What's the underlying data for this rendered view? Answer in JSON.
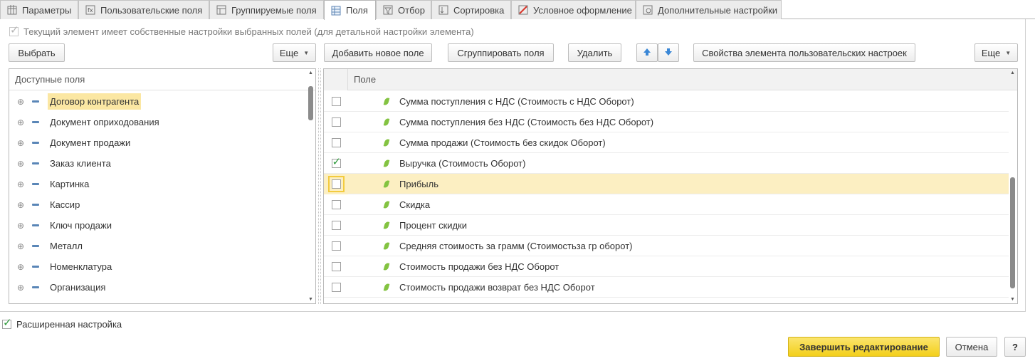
{
  "tabs": [
    {
      "label": "Параметры",
      "icon": "parameters-icon",
      "active": false
    },
    {
      "label": "Пользовательские поля",
      "icon": "custom-fields-icon",
      "active": false
    },
    {
      "label": "Группируемые поля",
      "icon": "grouped-fields-icon",
      "active": false
    },
    {
      "label": "Поля",
      "icon": "fields-icon",
      "active": true
    },
    {
      "label": "Отбор",
      "icon": "filter-icon",
      "active": false
    },
    {
      "label": "Сортировка",
      "icon": "sort-icon",
      "active": false
    },
    {
      "label": "Условное оформление",
      "icon": "conditional-format-icon",
      "active": false
    },
    {
      "label": "Дополнительные настройки",
      "icon": "settings-icon",
      "active": false
    }
  ],
  "own_settings_label": "Текущий элемент имеет собственные настройки выбранных полей (для детальной настройки элемента)",
  "own_settings_checked": true,
  "toolbar_left": {
    "select_label": "Выбрать",
    "more_label": "Еще"
  },
  "toolbar_right": {
    "add_field_label": "Добавить новое поле",
    "group_fields_label": "Сгруппировать поля",
    "delete_label": "Удалить",
    "move_up_icon": "arrow-up-icon",
    "move_down_icon": "arrow-down-icon",
    "properties_label": "Свойства элемента пользовательских настроек",
    "more_label": "Еще"
  },
  "available_fields": {
    "header": "Доступные поля",
    "items": [
      {
        "label": "Договор контрагента",
        "selected": true
      },
      {
        "label": "Документ оприходования",
        "selected": false
      },
      {
        "label": "Документ продажи",
        "selected": false
      },
      {
        "label": "Заказ клиента",
        "selected": false
      },
      {
        "label": "Картинка",
        "selected": false
      },
      {
        "label": "Кассир",
        "selected": false
      },
      {
        "label": "Ключ продажи",
        "selected": false
      },
      {
        "label": "Металл",
        "selected": false
      },
      {
        "label": "Номенклатура",
        "selected": false
      },
      {
        "label": "Организация",
        "selected": false
      }
    ]
  },
  "selected_fields": {
    "header": "Поле",
    "items": [
      {
        "label": "Сумма поступления с НДС (Стоимость с НДС Оборот)",
        "checked": false,
        "selected": false
      },
      {
        "label": "Сумма поступления без НДС (Стоимость без НДС Оборот)",
        "checked": false,
        "selected": false
      },
      {
        "label": "Сумма продажи (Стоимость без скидок Оборот)",
        "checked": false,
        "selected": false
      },
      {
        "label": "Выручка (Стоимость Оборот)",
        "checked": true,
        "selected": false
      },
      {
        "label": "Прибыль",
        "checked": false,
        "selected": true
      },
      {
        "label": "Скидка",
        "checked": false,
        "selected": false
      },
      {
        "label": "Процент скидки",
        "checked": false,
        "selected": false
      },
      {
        "label": "Средняя стоимость за грамм (Стоимостьза гр оборот)",
        "checked": false,
        "selected": false
      },
      {
        "label": "Стоимость продажи без НДС Оборот",
        "checked": false,
        "selected": false
      },
      {
        "label": "Стоимость продажи возврат без НДС Оборот",
        "checked": false,
        "selected": false
      }
    ]
  },
  "advanced_setting_label": "Расширенная настройка",
  "advanced_setting_checked": true,
  "footer": {
    "finish_label": "Завершить редактирование",
    "cancel_label": "Отмена",
    "help_label": "?"
  },
  "colors": {
    "accent_yellow": "#f3cf1a",
    "selection": "#fcefc2",
    "check_green": "#2f9a3c",
    "arrow_blue": "#3a87d6"
  }
}
